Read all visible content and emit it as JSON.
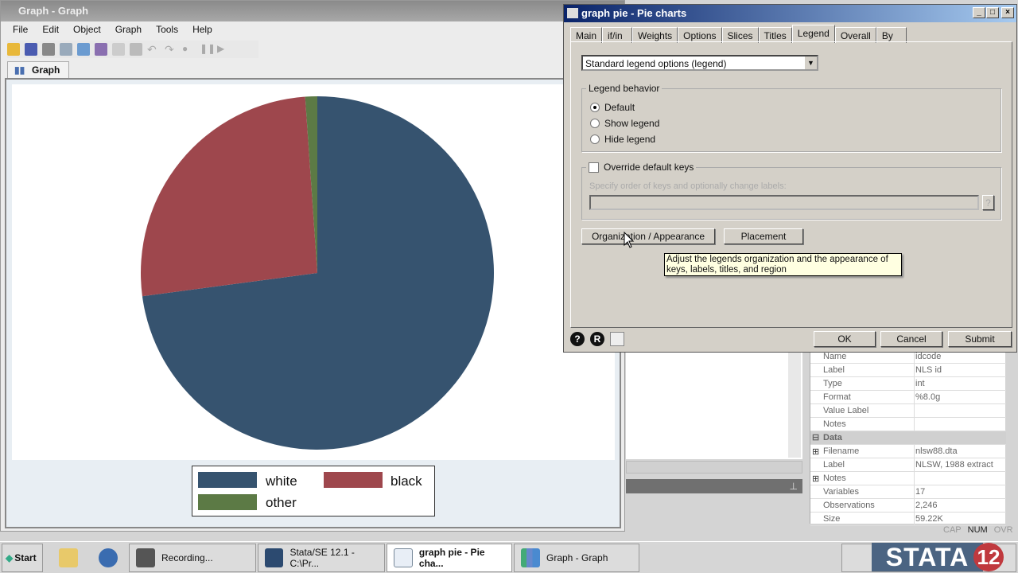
{
  "graph_window": {
    "title": "Graph - Graph",
    "menu": [
      "File",
      "Edit",
      "Object",
      "Graph",
      "Tools",
      "Help"
    ],
    "tab": "Graph",
    "toolbar_icons": [
      "open-icon",
      "save-icon",
      "print-icon",
      "copy-icon",
      "copy-graph-icon",
      "graph-editor-icon",
      "blank-icon",
      "pointer-icon",
      "undo-icon",
      "redo-icon",
      "record-icon",
      "pause-icon",
      "play-icon"
    ]
  },
  "chart_data": {
    "type": "pie",
    "categories": [
      "white",
      "black",
      "other"
    ],
    "values": [
      72.9,
      26.0,
      1.1
    ],
    "colors": [
      "#36536f",
      "#9e474d",
      "#5c7a45"
    ],
    "start_angle": "12 o'clock",
    "direction": "clockwise",
    "legend": {
      "placement": "bottom",
      "entries": [
        "white",
        "black",
        "other"
      ]
    }
  },
  "properties": {
    "rows": [
      {
        "k": "Name",
        "v": "idcode"
      },
      {
        "k": "Label",
        "v": "NLS id"
      },
      {
        "k": "Type",
        "v": "int"
      },
      {
        "k": "Format",
        "v": "%8.0g"
      },
      {
        "k": "Value Label",
        "v": ""
      },
      {
        "k": "Notes",
        "v": ""
      }
    ],
    "data_header": "Data",
    "data_rows": [
      {
        "k": "Filename",
        "v": "nlsw88.dta"
      },
      {
        "k": "Label",
        "v": "NLSW, 1988 extract"
      },
      {
        "k": "Notes",
        "v": ""
      },
      {
        "k": "Variables",
        "v": "17"
      },
      {
        "k": "Observations",
        "v": "2,246"
      },
      {
        "k": "Size",
        "v": "59.22K"
      }
    ]
  },
  "status": {
    "cap": "CAP",
    "num": "NUM",
    "ovr": "OVR"
  },
  "dialog": {
    "title": "graph pie - Pie charts",
    "tabs": [
      "Main",
      "if/in",
      "Weights",
      "Options",
      "Slices",
      "Titles",
      "Legend",
      "Overall",
      "By"
    ],
    "active_tab": "Legend",
    "legend_select": "Standard legend options (legend)",
    "behavior_label": "Legend behavior",
    "behavior_options": [
      "Default",
      "Show legend",
      "Hide legend"
    ],
    "behavior_selected": "Default",
    "override_label": "Override default keys",
    "override_checked": false,
    "keys_label": "Specify order of keys and optionally change labels:",
    "keys_value": "",
    "keys_help": "?",
    "org_button": "Organization / Appearance",
    "placement_button": "Placement",
    "tooltip": "Adjust the legends organization and the appearance of keys, labels, titles, and region",
    "ok": "OK",
    "cancel": "Cancel",
    "submit": "Submit"
  },
  "taskbar": {
    "start": "Start",
    "tasks": [
      "Recording...",
      "Stata/SE 12.1 - C:\\Pr...",
      "graph pie - Pie cha...",
      "Graph - Graph"
    ],
    "active": "graph pie - Pie cha...",
    "logo": "STATA 12"
  }
}
